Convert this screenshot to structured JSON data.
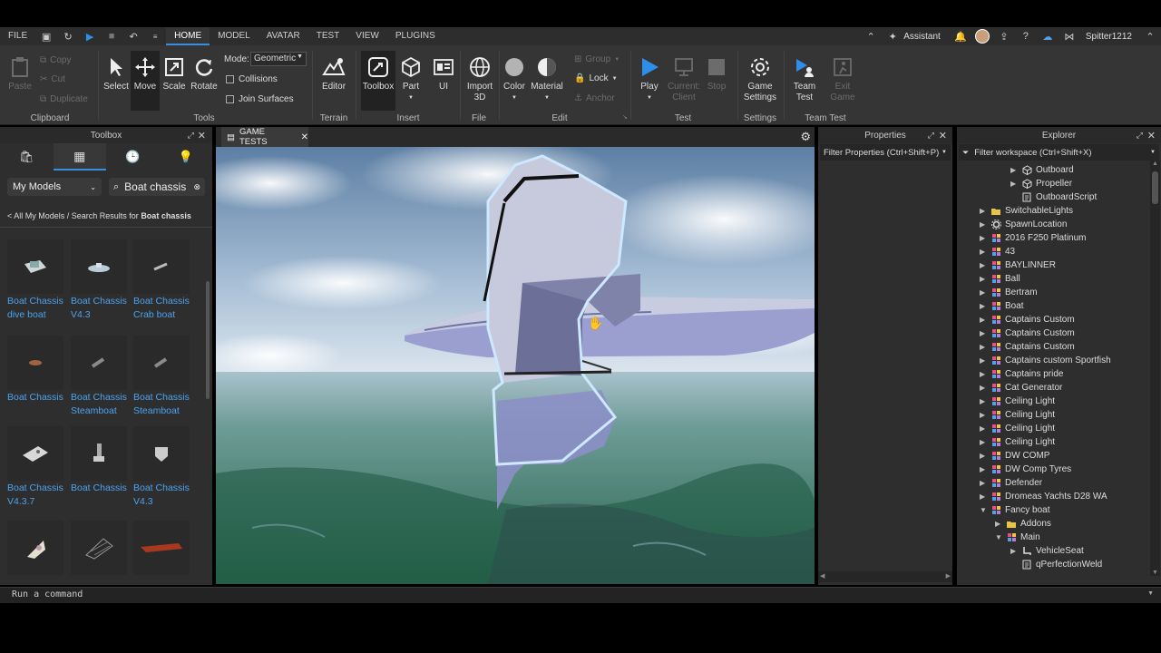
{
  "menu": {
    "file": "FILE",
    "tabs": [
      "HOME",
      "MODEL",
      "AVATAR",
      "TEST",
      "VIEW",
      "PLUGINS"
    ],
    "assistant": "Assistant",
    "username": "Spitter1212"
  },
  "ribbon": {
    "clipboard": {
      "paste": "Paste",
      "copy": "Copy",
      "cut": "Cut",
      "duplicate": "Duplicate",
      "label": "Clipboard"
    },
    "tools": {
      "select": "Select",
      "move": "Move",
      "scale": "Scale",
      "rotate": "Rotate",
      "mode_label": "Mode:",
      "mode_value": "Geometric",
      "collisions": "Collisions",
      "join_surfaces": "Join Surfaces",
      "label": "Tools"
    },
    "terrain": {
      "editor": "Editor",
      "label": "Terrain"
    },
    "insert": {
      "toolbox": "Toolbox",
      "part": "Part",
      "ui": "UI",
      "label": "Insert"
    },
    "file": {
      "import3d_line1": "Import",
      "import3d_line2": "3D",
      "label": "File"
    },
    "edit": {
      "color": "Color",
      "material": "Material",
      "group": "Group",
      "lock": "Lock",
      "anchor": "Anchor",
      "label": "Edit"
    },
    "test": {
      "play": "Play",
      "current_line1": "Current:",
      "current_line2": "Client",
      "stop": "Stop",
      "label": "Test"
    },
    "settings": {
      "game_line1": "Game",
      "game_line2": "Settings",
      "label": "Settings"
    },
    "team_test": {
      "team_line1": "Team",
      "team_line2": "Test",
      "exit_line1": "Exit",
      "exit_line2": "Game",
      "label": "Team Test"
    }
  },
  "toolbox": {
    "title": "Toolbox",
    "category": "My Models",
    "search_value": "Boat chassis",
    "breadcrumb_prefix": "< All My Models / Search Results for ",
    "breadcrumb_query": "Boat chassis",
    "items": [
      {
        "line1": "Boat Chassis",
        "line2": "dive boat"
      },
      {
        "line1": "Boat Chassis",
        "line2": "V4.3"
      },
      {
        "line1": "Boat Chassis",
        "line2": "Crab boat"
      },
      {
        "line1": "Boat Chassis",
        "line2": ""
      },
      {
        "line1": "Boat Chassis",
        "line2": "Steamboat"
      },
      {
        "line1": "Boat Chassis",
        "line2": "Steamboat"
      },
      {
        "line1": "Boat Chassis",
        "line2": "V4.3.7"
      },
      {
        "line1": "Boat Chassis",
        "line2": ""
      },
      {
        "line1": "Boat Chassis",
        "line2": "V4.3"
      }
    ]
  },
  "viewport": {
    "tab_label": "GAME TESTS"
  },
  "properties": {
    "title": "Properties",
    "filter_placeholder": "Filter Properties (Ctrl+Shift+P)"
  },
  "explorer": {
    "title": "Explorer",
    "filter_placeholder": "Filter workspace (Ctrl+Shift+X)",
    "rows": [
      {
        "label": "Outboard",
        "depth": 3,
        "arrow": "▶",
        "icon": "model"
      },
      {
        "label": "Propeller",
        "depth": 3,
        "arrow": "▶",
        "icon": "model"
      },
      {
        "label": "OutboardScript",
        "depth": 3,
        "arrow": "",
        "icon": "script"
      },
      {
        "label": "SwitchableLights",
        "depth": 1,
        "arrow": "▶",
        "icon": "folder"
      },
      {
        "label": "SpawnLocation",
        "depth": 1,
        "arrow": "▶",
        "icon": "spawn"
      },
      {
        "label": "2016 F250 Platinum",
        "depth": 1,
        "arrow": "▶",
        "icon": "group"
      },
      {
        "label": "43",
        "depth": 1,
        "arrow": "▶",
        "icon": "group"
      },
      {
        "label": "BAYLINNER",
        "depth": 1,
        "arrow": "▶",
        "icon": "group"
      },
      {
        "label": "Ball",
        "depth": 1,
        "arrow": "▶",
        "icon": "group"
      },
      {
        "label": "Bertram",
        "depth": 1,
        "arrow": "▶",
        "icon": "group"
      },
      {
        "label": "Boat",
        "depth": 1,
        "arrow": "▶",
        "icon": "group"
      },
      {
        "label": "Captains Custom",
        "depth": 1,
        "arrow": "▶",
        "icon": "group"
      },
      {
        "label": "Captains Custom",
        "depth": 1,
        "arrow": "▶",
        "icon": "group"
      },
      {
        "label": "Captains Custom",
        "depth": 1,
        "arrow": "▶",
        "icon": "group"
      },
      {
        "label": "Captains custom Sportfish",
        "depth": 1,
        "arrow": "▶",
        "icon": "group"
      },
      {
        "label": "Captains pride",
        "depth": 1,
        "arrow": "▶",
        "icon": "group"
      },
      {
        "label": "Cat Generator",
        "depth": 1,
        "arrow": "▶",
        "icon": "group"
      },
      {
        "label": "Ceiling Light",
        "depth": 1,
        "arrow": "▶",
        "icon": "group"
      },
      {
        "label": "Ceiling Light",
        "depth": 1,
        "arrow": "▶",
        "icon": "group"
      },
      {
        "label": "Ceiling Light",
        "depth": 1,
        "arrow": "▶",
        "icon": "group"
      },
      {
        "label": "Ceiling Light",
        "depth": 1,
        "arrow": "▶",
        "icon": "group"
      },
      {
        "label": "DW COMP",
        "depth": 1,
        "arrow": "▶",
        "icon": "group"
      },
      {
        "label": "DW Comp Tyres",
        "depth": 1,
        "arrow": "▶",
        "icon": "group"
      },
      {
        "label": "Defender",
        "depth": 1,
        "arrow": "▶",
        "icon": "group"
      },
      {
        "label": "Dromeas Yachts D28 WA",
        "depth": 1,
        "arrow": "▶",
        "icon": "group"
      },
      {
        "label": "Fancy boat",
        "depth": 1,
        "arrow": "▼",
        "icon": "group"
      },
      {
        "label": "Addons",
        "depth": 2,
        "arrow": "▶",
        "icon": "folder"
      },
      {
        "label": "Main",
        "depth": 2,
        "arrow": "▼",
        "icon": "group"
      },
      {
        "label": "VehicleSeat",
        "depth": 3,
        "arrow": "▶",
        "icon": "seat"
      },
      {
        "label": "qPerfectionWeld",
        "depth": 3,
        "arrow": "",
        "icon": "script"
      }
    ]
  },
  "command_bar": {
    "placeholder": "Run a command"
  },
  "colors": {
    "accent": "#3b8ede",
    "link": "#4aa3f0",
    "play": "#2f8fe8"
  }
}
